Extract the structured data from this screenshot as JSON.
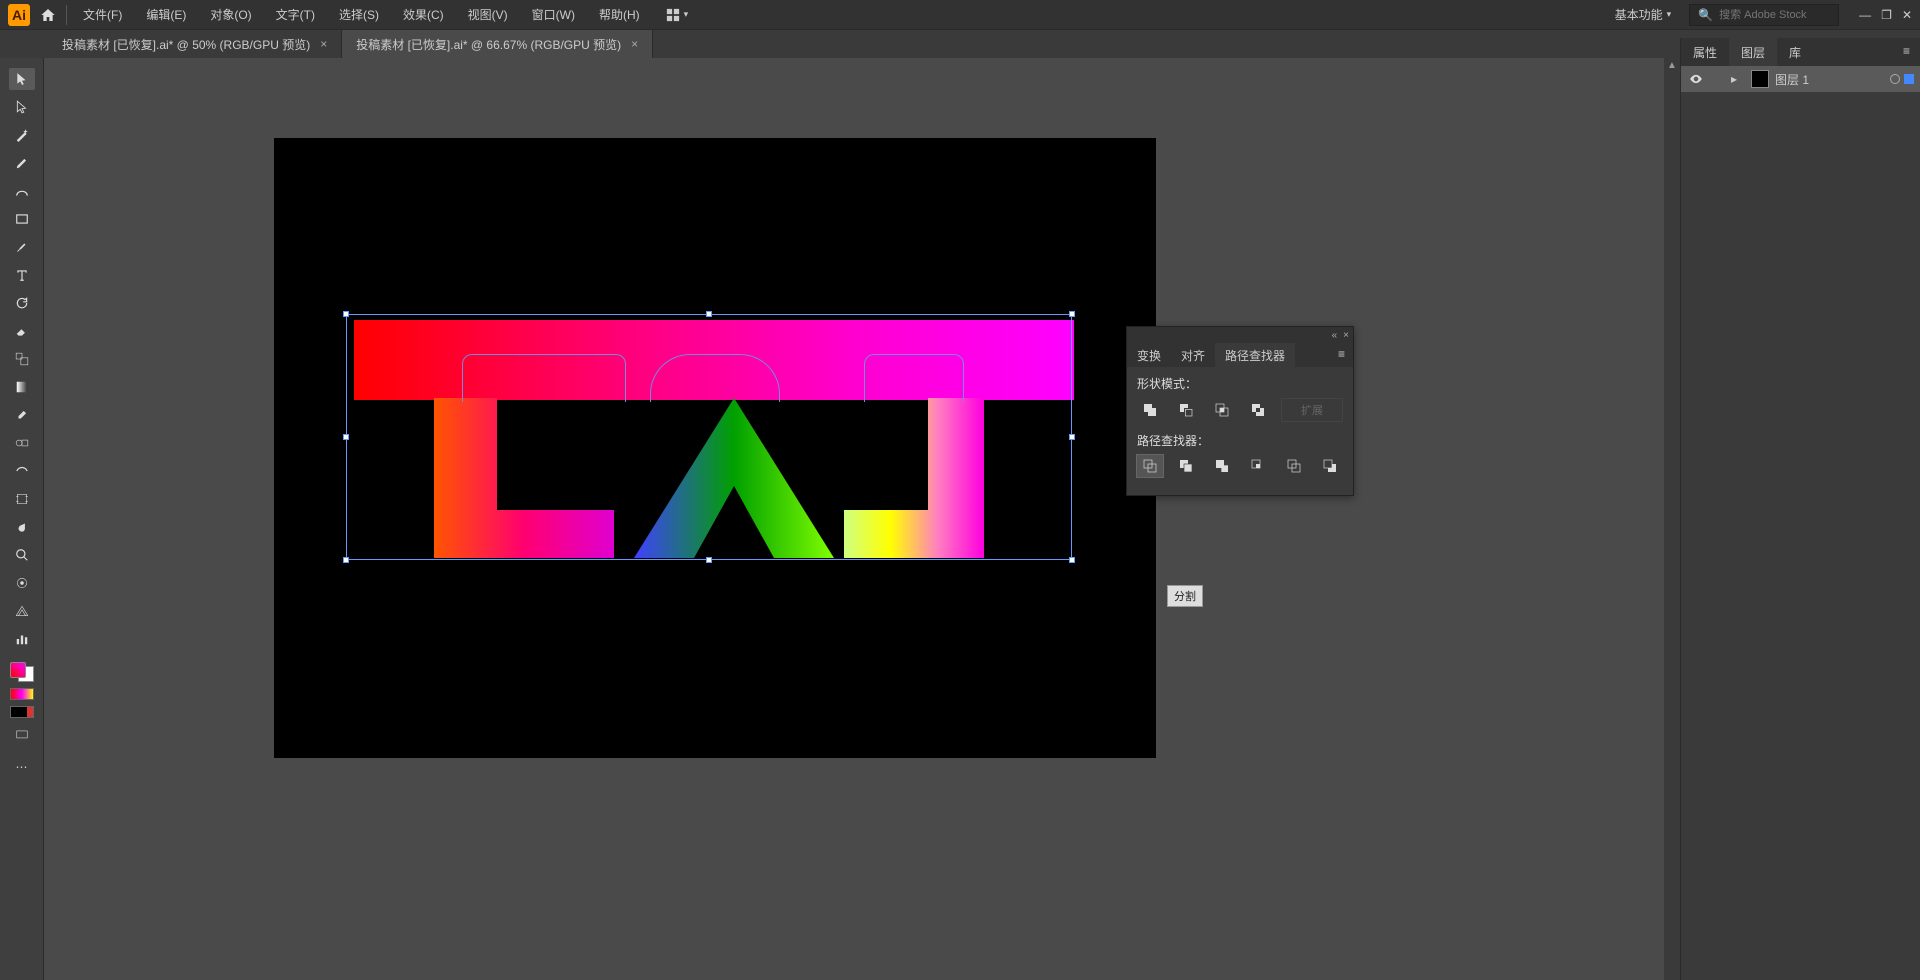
{
  "app": {
    "logo_text": "Ai"
  },
  "menu": {
    "file": "文件(F)",
    "edit": "编辑(E)",
    "object": "对象(O)",
    "type": "文字(T)",
    "select": "选择(S)",
    "effect": "效果(C)",
    "view": "视图(V)",
    "window": "窗口(W)",
    "help": "帮助(H)"
  },
  "workspace": {
    "label": "基本功能"
  },
  "search": {
    "placeholder": "搜索 Adobe Stock"
  },
  "tabs": [
    {
      "label": "投稿素材  [已恢复].ai* @ 50% (RGB/GPU 预览)",
      "active": false
    },
    {
      "label": "投稿素材  [已恢复].ai* @ 66.67% (RGB/GPU 预览)",
      "active": true
    }
  ],
  "right_panel": {
    "tabs": {
      "properties": "属性",
      "layers": "图层",
      "libraries": "库"
    },
    "layer_name": "图层 1"
  },
  "pathfinder": {
    "tabs": {
      "transform": "变换",
      "align": "对齐",
      "pathfinder": "路径查找器"
    },
    "shape_mode_label": "形状模式：",
    "pathfinder_label": "路径查找器：",
    "expand_label": "扩展",
    "tooltip": "分割"
  },
  "win_controls": {
    "min": "—",
    "max": "❐",
    "close": "✕"
  }
}
